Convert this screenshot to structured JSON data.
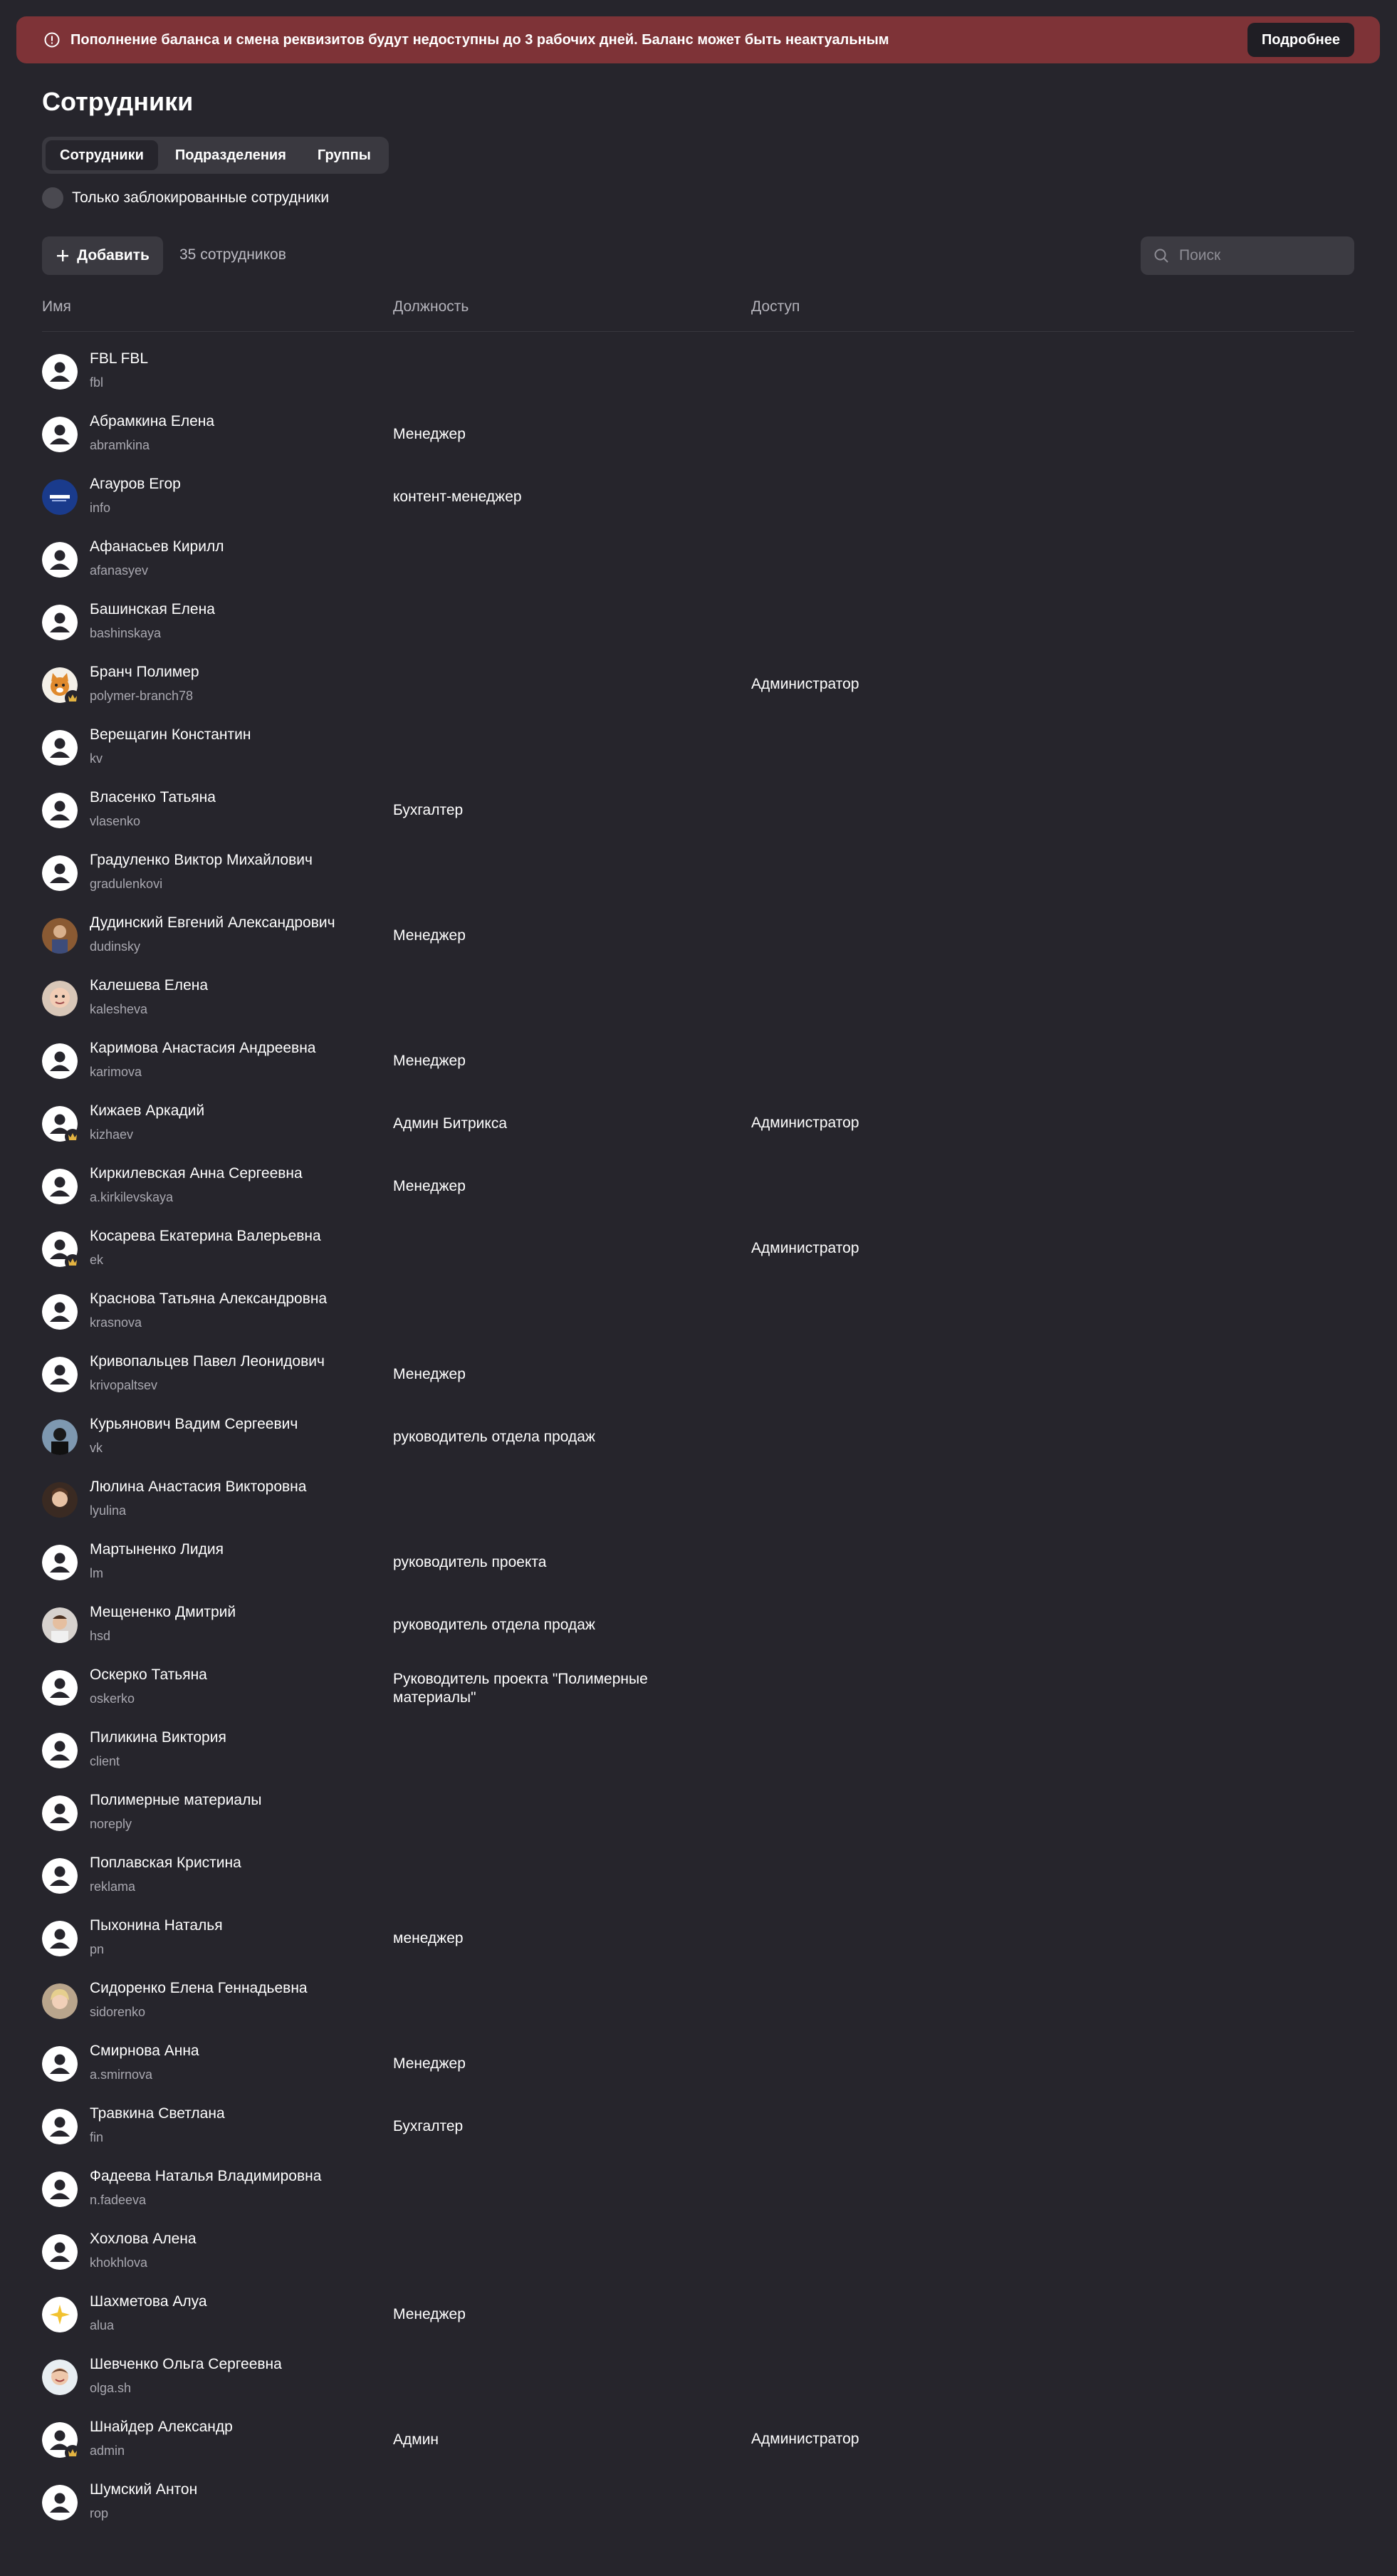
{
  "banner": {
    "text": "Пополнение баланса и смена реквизитов будут недоступны до 3 рабочих дней. Баланс может быть неактуальным",
    "button": "Подробнее",
    "color": "#7e3337"
  },
  "page": {
    "title": "Сотрудники"
  },
  "tabs": [
    "Сотрудники",
    "Подразделения",
    "Группы"
  ],
  "filter": {
    "blocked_only": "Только заблокированные сотрудники"
  },
  "toolbar": {
    "add": "Добавить",
    "count": "35 сотрудников",
    "search_placeholder": "Поиск"
  },
  "columns": {
    "name": "Имя",
    "position": "Должность",
    "access": "Доступ"
  },
  "colors": {
    "background": "#26252c",
    "banner": "#7e3337",
    "crown": "#e3b341"
  },
  "employees": [
    {
      "name": "FBL FBL",
      "login": "fbl",
      "position": "",
      "access": "",
      "avatar": "default"
    },
    {
      "name": "Абрамкина Елена",
      "login": "abramkina",
      "position": "Менеджер",
      "access": "",
      "avatar": "default"
    },
    {
      "name": "Агауров Егор",
      "login": "info",
      "position": "контент-менеджер",
      "access": "",
      "avatar": "logo"
    },
    {
      "name": "Афанасьев Кирилл",
      "login": "afanasyev",
      "position": "",
      "access": "",
      "avatar": "default"
    },
    {
      "name": "Башинская Елена",
      "login": "bashinskaya",
      "position": "",
      "access": "",
      "avatar": "default"
    },
    {
      "name": "Бранч Полимер",
      "login": "polymer-branch78",
      "position": "",
      "access": "Администратор",
      "avatar": "cat",
      "admin": true
    },
    {
      "name": "Верещагин Константин",
      "login": "kv",
      "position": "",
      "access": "",
      "avatar": "default"
    },
    {
      "name": "Власенко Татьяна",
      "login": "vlasenko",
      "position": "Бухгалтер",
      "access": "",
      "avatar": "default"
    },
    {
      "name": "Градуленко Виктор Михайлович",
      "login": "gradulenkovi",
      "position": "",
      "access": "",
      "avatar": "default"
    },
    {
      "name": "Дудинский Евгений Александрович",
      "login": "dudinsky",
      "position": "Менеджер",
      "access": "",
      "avatar": "photo-brown"
    },
    {
      "name": "Калешева Елена",
      "login": "kalesheva",
      "position": "",
      "access": "",
      "avatar": "photo-face"
    },
    {
      "name": "Каримова Анастасия Андреевна",
      "login": "karimova",
      "position": "Менеджер",
      "access": "",
      "avatar": "default"
    },
    {
      "name": "Кижаев Аркадий",
      "login": "kizhaev",
      "position": "Админ Битрикса",
      "access": "Администратор",
      "avatar": "default",
      "admin": true
    },
    {
      "name": "Киркилевская Анна Сергеевна",
      "login": "a.kirkilevskaya",
      "position": "Менеджер",
      "access": "",
      "avatar": "default"
    },
    {
      "name": "Косарева Екатерина Валерьевна",
      "login": "ek",
      "position": "",
      "access": "Администратор",
      "avatar": "default",
      "admin": true
    },
    {
      "name": "Краснова Татьяна Александровна",
      "login": "krasnova",
      "position": "",
      "access": "",
      "avatar": "default"
    },
    {
      "name": "Кривопальцев Павел Леонидович",
      "login": "krivopaltsev",
      "position": "Менеджер",
      "access": "",
      "avatar": "default"
    },
    {
      "name": "Курьянович Вадим Сергеевич",
      "login": "vk",
      "position": "руководитель отдела продаж",
      "access": "",
      "avatar": "photo-dark"
    },
    {
      "name": "Люлина Анастасия Викторовна",
      "login": "lyulina",
      "position": "",
      "access": "",
      "avatar": "photo-woman"
    },
    {
      "name": "Мартыненко Лидия",
      "login": "lm",
      "position": "руководитель проекта",
      "access": "",
      "avatar": "default"
    },
    {
      "name": "Мещененко Дмитрий",
      "login": "hsd",
      "position": "руководитель отдела продаж",
      "access": "",
      "avatar": "photo-man"
    },
    {
      "name": "Оскерко Татьяна",
      "login": "oskerko",
      "position": "Руководитель проекта \"Полимерные материалы\"",
      "access": "",
      "avatar": "default"
    },
    {
      "name": "Пиликина Виктория",
      "login": "client",
      "position": "",
      "access": "",
      "avatar": "default"
    },
    {
      "name": "Полимерные материалы",
      "login": "noreply",
      "position": "",
      "access": "",
      "avatar": "default"
    },
    {
      "name": "Поплавская Кристина",
      "login": "reklama",
      "position": "",
      "access": "",
      "avatar": "default"
    },
    {
      "name": "Пыхонина Наталья",
      "login": "pn",
      "position": "менеджер",
      "access": "",
      "avatar": "default"
    },
    {
      "name": "Сидоренко Елена Геннадьевна",
      "login": "sidorenko",
      "position": "",
      "access": "",
      "avatar": "photo-blonde"
    },
    {
      "name": "Смирнова Анна",
      "login": "a.smirnova",
      "position": "Менеджер",
      "access": "",
      "avatar": "default"
    },
    {
      "name": "Травкина Светлана",
      "login": "fin",
      "position": "Бухгалтер",
      "access": "",
      "avatar": "default"
    },
    {
      "name": "Фадеева Наталья Владимировна",
      "login": "n.fadeeva",
      "position": "",
      "access": "",
      "avatar": "default"
    },
    {
      "name": "Хохлова Алена",
      "login": "khokhlova",
      "position": "",
      "access": "",
      "avatar": "default"
    },
    {
      "name": "Шахметова Алуа",
      "login": "alua",
      "position": "Менеджер",
      "access": "",
      "avatar": "sparkle"
    },
    {
      "name": "Шевченко Ольга Сергеевна",
      "login": "olga.sh",
      "position": "",
      "access": "",
      "avatar": "photo-smile"
    },
    {
      "name": "Шнайдер Александр",
      "login": "admin",
      "position": "Админ",
      "access": "Администратор",
      "avatar": "default",
      "admin": true
    },
    {
      "name": "Шумский Антон",
      "login": "rop",
      "position": "",
      "access": "",
      "avatar": "default"
    }
  ]
}
